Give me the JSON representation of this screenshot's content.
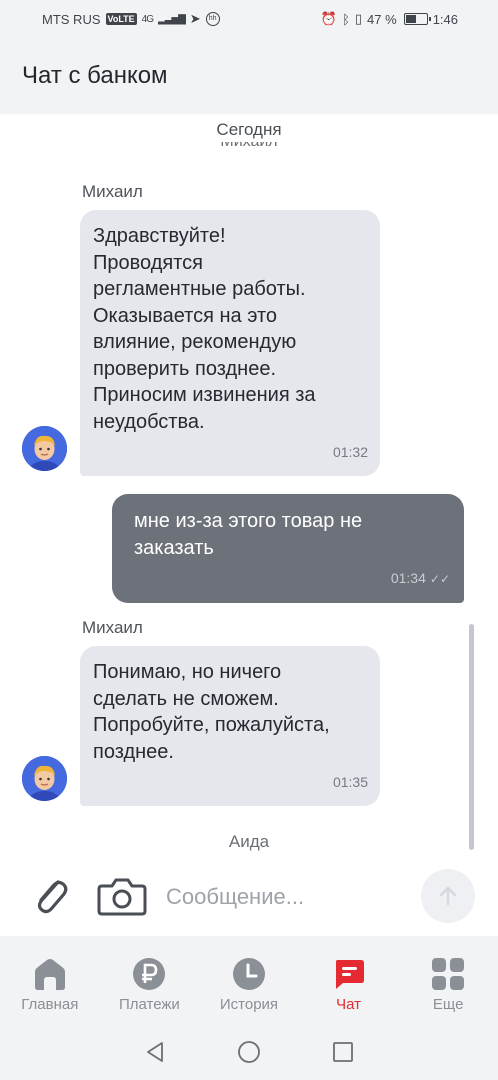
{
  "status_bar": {
    "carrier": "MTS RUS",
    "volte": "VoLTE",
    "network": "4G",
    "battery_percent": "47 %",
    "battery_level": 0.47,
    "time": "1:46"
  },
  "header": {
    "title": "Чат с банком"
  },
  "chat": {
    "date_label": "Сегодня",
    "clipped_name": "Михаил",
    "messages": [
      {
        "sender": "Михаил",
        "lines": [
          "Здравствуйте!",
          "Проводятся",
          "регламентные работы.",
          "Оказывается на это",
          "влияние, рекомендую",
          "проверить позднее.",
          "Приносим извинения за",
          "неудобства."
        ],
        "time": "01:32"
      },
      {
        "lines": [
          "мне из-за этого товар не",
          "заказать"
        ],
        "time": "01:34",
        "read_icon": "double-check-icon"
      },
      {
        "sender": "Михаил",
        "lines": [
          "Понимаю, но ничего",
          "сделать не сможем.",
          "Попробуйте, пожалуйста,",
          "позднее."
        ],
        "time": "01:35"
      }
    ],
    "next_sender": "Аида"
  },
  "input": {
    "placeholder": "Сообщение...",
    "value": "",
    "attach_icon": "paperclip-icon",
    "camera_icon": "camera-icon",
    "send_icon": "arrow-up-icon"
  },
  "nav": {
    "items": [
      {
        "label": "Главная",
        "icon": "home-icon"
      },
      {
        "label": "Платежи",
        "icon": "ruble-icon"
      },
      {
        "label": "История",
        "icon": "clock-icon"
      },
      {
        "label": "Чат",
        "icon": "chat-icon",
        "active": true
      },
      {
        "label": "Еще",
        "icon": "grid-icon"
      }
    ]
  },
  "colors": {
    "accent": "#e52b31",
    "incoming_bubble": "#e5e7ec",
    "outgoing_bubble": "#6c717a",
    "nav_inactive": "#8b8f96",
    "chrome_bg": "#f2f3f5"
  }
}
